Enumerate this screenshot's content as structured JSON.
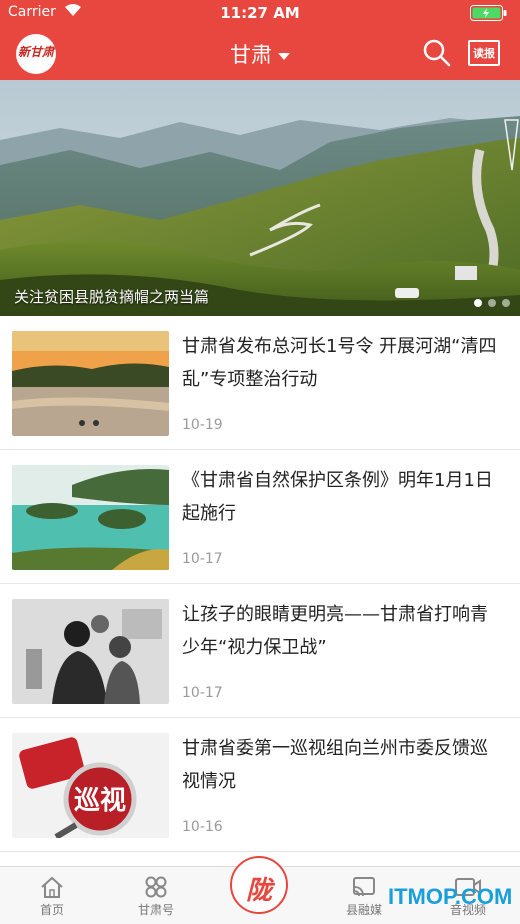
{
  "status_bar": {
    "carrier": "Carrier",
    "time": "11:27 AM"
  },
  "nav": {
    "logo_text": "新甘肃",
    "city": "甘肃",
    "paper_label": "读报"
  },
  "banner": {
    "caption": "关注贫困县脱贫摘帽之两当篇",
    "page_count": 3,
    "active_index": 0
  },
  "news": [
    {
      "title": "甘肃省发布总河长1号令 开展河湖“清四乱”专项整治行动",
      "date": "10-19"
    },
    {
      "title": "《甘肃省自然保护区条例》明年1月1日起施行",
      "date": "10-17"
    },
    {
      "title": "让孩子的眼睛更明亮——甘肃省打响青少年“视力保卫战”",
      "date": "10-17"
    },
    {
      "title": "甘肃省委第一巡视组向兰州市委反馈巡视情况",
      "date": "10-16",
      "thumb_text": "巡视"
    }
  ],
  "tabbar": {
    "home": "首页",
    "gansu_hao": "甘肃号",
    "center_logo": "陇",
    "county_media": "县融媒",
    "audio_video": "音视频"
  },
  "watermark": "ITMOP.COM",
  "colors": {
    "brand": "#e8473f",
    "date_gray": "#9a9a9a"
  }
}
